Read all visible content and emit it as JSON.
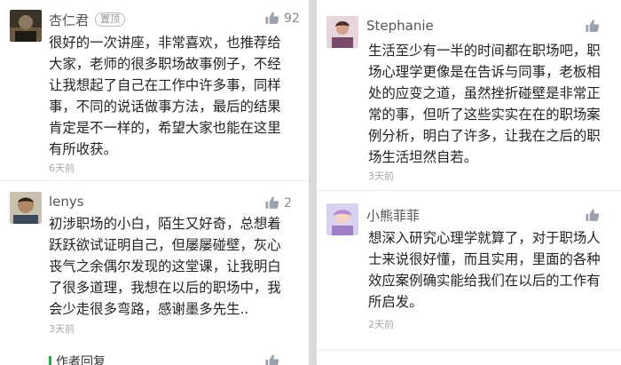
{
  "left_column": {
    "comments": [
      {
        "username": "杏仁君",
        "pinned_badge": "置顶",
        "likes": "92",
        "lines": [
          "很好的一次讲座，非常喜欢，也推荐给",
          "大家，老师的很多职场故事例子，不经",
          "让我想起了自己在工作中许多事，同样",
          "事，不同的说话做事方法，最后的结果",
          "肯定是不一样的，希望大家也能在这里",
          "有所收获。"
        ],
        "time": "6天前"
      },
      {
        "username": "lenys",
        "likes": "2",
        "lines": [
          "初涉职场的小白，陌生又好奇，总想着",
          "跃跃欲试证明自己，但屡屡碰壁，灰心",
          "丧气之余偶尔发现的这堂课，让我明白",
          "了很多道理，我想在以后的职场中，我",
          "会少走很多弯路，感谢墨多先生.."
        ],
        "time": "3天前"
      }
    ],
    "author_reply_label": "作者回复"
  },
  "right_column": {
    "comments": [
      {
        "username": "Stephanie",
        "likes": "",
        "lines": [
          "生活至少有一半的时间都在职场吧，职",
          "场心理学更像是在告诉与同事，老板相",
          "处的应变之道，虽然挫折碰壁是非常正",
          "常的事，但听了这些实实在在的职场案",
          "例分析，明白了许多，让我在之后的职",
          "场生活坦然自若。"
        ],
        "time": "3天前"
      },
      {
        "username": "小熊菲菲",
        "likes": "",
        "lines": [
          "想深入研究心理学就算了，对于职场人",
          "士来说很好懂，而且实用，里面的各种",
          "效应案例确实能给我们在以后的工作有",
          "所启发。"
        ],
        "time": "2天前"
      }
    ]
  },
  "icons": {
    "like": "thumbs-up-icon"
  },
  "colors": {
    "page_gap": "#d9d9d9",
    "author_accent": "#2ea84a",
    "like_icon": "#9aa3ad"
  }
}
